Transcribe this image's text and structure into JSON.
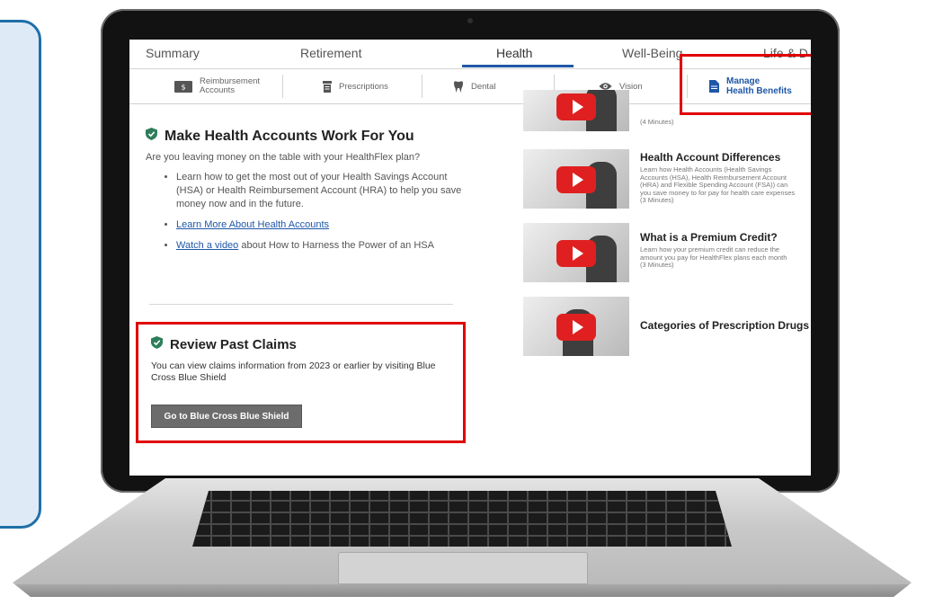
{
  "top_tabs": [
    "Summary",
    "Retirement",
    "Health",
    "Well-Being",
    "Life & D"
  ],
  "active_top_tab": "Health",
  "sub_tabs": {
    "reimbursement": "Reimbursement Accounts",
    "prescriptions": "Prescriptions",
    "dental": "Dental",
    "vision": "Vision",
    "manage_line1": "Manage",
    "manage_line2": "Health Benefits"
  },
  "health_accounts": {
    "title": "Make Health Accounts Work For You",
    "intro": "Are you leaving money on the table with your HealthFlex plan?",
    "bullet1": "Learn how to get the most out of your Health Savings Account (HSA) or Health Reimbursement Account (HRA) to help you save money now and in the future.",
    "bullet2_link": "Learn More About Health Accounts",
    "bullet3_link": "Watch a video",
    "bullet3_rest": " about How to Harness the Power of an HSA"
  },
  "past_claims": {
    "title": "Review Past Claims",
    "text": "You can view claims information from 2023 or earlier by visiting Blue Cross Blue Shield",
    "button": "Go to Blue Cross Blue Shield"
  },
  "videos": [
    {
      "title": "",
      "desc_lines": [
        "(4 Minutes)"
      ]
    },
    {
      "title": "Health Account Differences",
      "desc_lines": [
        "Learn how Health Accounts (Health Savings",
        "Accounts (HSA), Health Reimbursement Account",
        "(HRA) and Flexible Spending Account (FSA)) can",
        "you save money to for pay for health care expenses",
        "(3 Minutes)"
      ]
    },
    {
      "title": "What is a Premium Credit?",
      "desc_lines": [
        "Learn how your premium credit can reduce the",
        "amount you pay for HealthFlex plans each month",
        "(3 Minutes)"
      ]
    },
    {
      "title": "Categories of Prescription Drugs",
      "desc_lines": []
    }
  ],
  "colors": {
    "accent": "#1f57a8",
    "highlight_box": "#e00000",
    "play_button": "#e02020",
    "section_icon": "#2e7d5b"
  }
}
